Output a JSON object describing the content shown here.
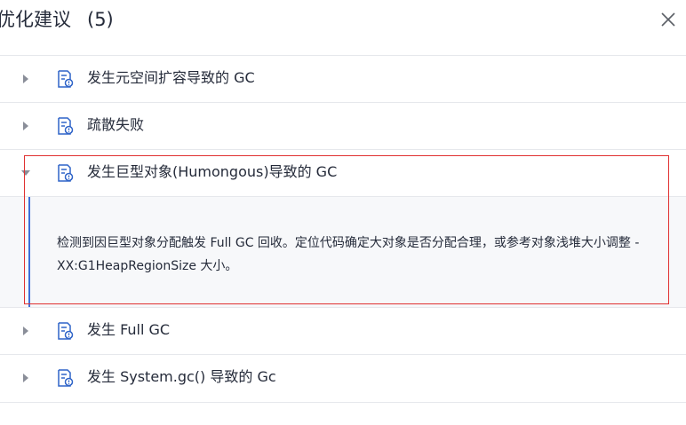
{
  "header": {
    "title": "优化建议",
    "count": "(5)"
  },
  "items": [
    {
      "label": "发生元空间扩容导致的 GC",
      "expanded": false
    },
    {
      "label": "疏散失败",
      "expanded": false
    },
    {
      "label": "发生巨型对象(Humongous)导致的 GC",
      "expanded": true,
      "description": "检测到因巨型对象分配触发 Full GC 回收。定位代码确定大对象是否分配合理，或参考对象浅堆大小调整 -XX:G1HeapRegionSize 大小。"
    },
    {
      "label": "发生 Full GC",
      "expanded": false
    },
    {
      "label": "发生 System.gc() 导致的 Gc",
      "expanded": false
    }
  ],
  "colors": {
    "accent": "#3f6fd9",
    "highlight": "#e03030",
    "icon_stroke": "#2f64c8",
    "caret": "#8a8e99"
  },
  "icons": {
    "collapsed": "caret-right-icon",
    "expanded": "caret-down-icon",
    "item": "document-alert-icon",
    "close": "close-icon"
  }
}
